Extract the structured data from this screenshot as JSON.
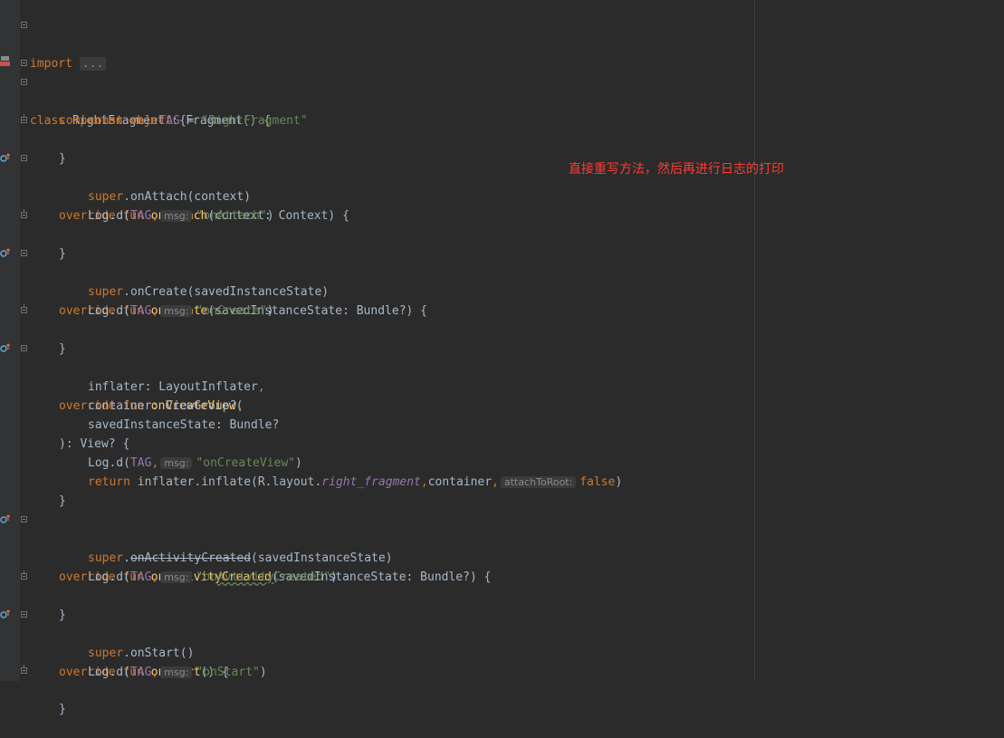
{
  "annotation": "直接重写方法，然后再进行日志的打印",
  "code": {
    "import_kw": "import",
    "import_folded": "...",
    "class_kw": "class",
    "class_decl": " RightFragment : Fragment() {",
    "companion_kw": "companion object",
    "open_brace": " {",
    "const_val": "const val ",
    "tag_name": "TAG",
    "eq": " = ",
    "tag_value": "\"RightFragment\"",
    "close_brace": "}",
    "override_fun": "override fun ",
    "super_kw": "super",
    "log_d": "Log.d(",
    "comma": ",",
    "msg_hint": "msg:",
    "close_paren": ")",
    "onAttach": {
      "name": "onAttach",
      "params": "(context: Context) {",
      "super_call": ".onAttach(context)",
      "log_msg": "\"onAttach\""
    },
    "onCreate": {
      "name": "onCreate",
      "params": "(savedInstanceState: Bundle?) {",
      "super_call": ".onCreate(savedInstanceState)",
      "log_msg": "\"onCreate\""
    },
    "onCreateView": {
      "name": "onCreateView",
      "open": "(",
      "p1": "inflater: LayoutInflater",
      "p2": "container: ViewGroup?",
      "p3": "savedInstanceState: Bundle?",
      "ret": "): View? {",
      "log_msg": "\"onCreateView\"",
      "return_kw": "return",
      "inflate": " inflater.inflate(R.layout.",
      "layout_name": "right_fragment",
      "container_arg": "container",
      "attach_hint": "attachToRoot:",
      "false_kw": "false"
    },
    "onActivityCreated": {
      "name": "onActivityCreated",
      "params": "(savedInstanceState: Bundle?) {",
      "super_method": "onActivityCreated",
      "super_args": "(savedInstanceState)",
      "log_msg_pre": "\"on",
      "log_msg_typo": "Avtivity",
      "log_msg_post": "Created\""
    },
    "onStart": {
      "name": "onStart",
      "params": "() {",
      "super_call": ".onStart()",
      "log_msg": "\"onStart\""
    }
  }
}
